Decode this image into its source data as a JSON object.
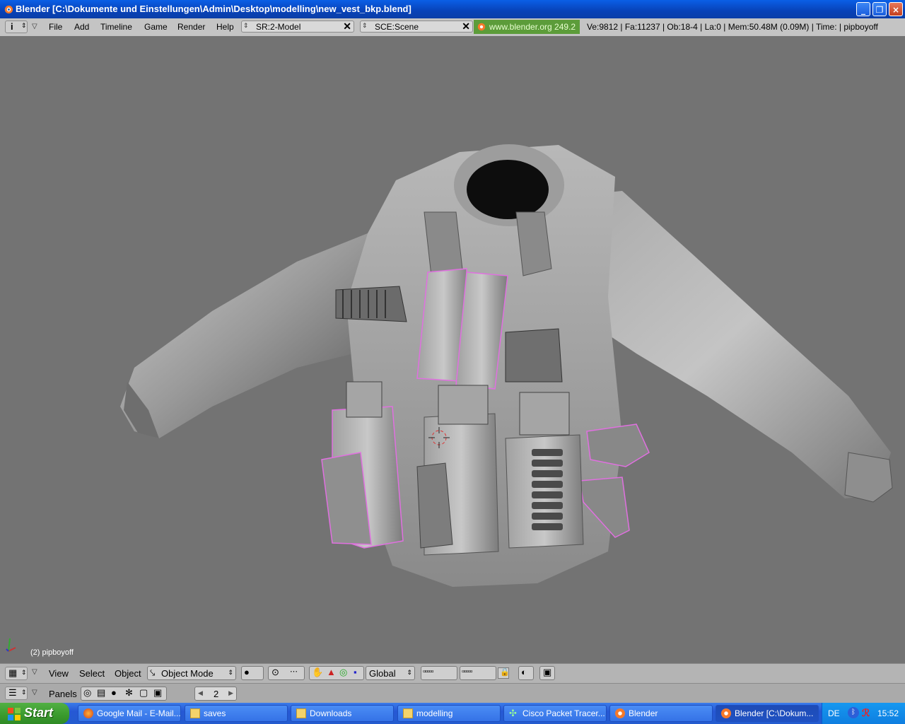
{
  "window": {
    "title": "Blender [C:\\Dokumente und Einstellungen\\Admin\\Desktop\\modelling\\new_vest_bkp.blend]",
    "controls": [
      "_",
      "❐",
      "×"
    ]
  },
  "menubar": {
    "menus": [
      "File",
      "Add",
      "Timeline",
      "Game",
      "Render",
      "Help"
    ],
    "screen_field": "SR:2-Model",
    "scene_field": "SCE:Scene",
    "site_link": "www.blender.org 249.2",
    "stats": "Ve:9812 | Fa:11237 | Ob:18-4 | La:0  | Mem:50.48M (0.09M)  | Time: | pipboyoff"
  },
  "viewport": {
    "object_label": "(2) pipboyoff",
    "background": "#737373",
    "selection_color": "#e070e0"
  },
  "header3d": {
    "menus": [
      "View",
      "Select",
      "Object"
    ],
    "mode": "Object Mode",
    "orientation": "Global"
  },
  "buttons_window": {
    "label": "Panels",
    "frame": "2"
  },
  "taskbar": {
    "start_label": "Start",
    "tasks": [
      {
        "label": "Google Mail - E-Mail...",
        "icon": "firefox-icon"
      },
      {
        "label": "saves",
        "icon": "folder-icon"
      },
      {
        "label": "Downloads",
        "icon": "folder-icon"
      },
      {
        "label": "modelling",
        "icon": "folder-icon"
      },
      {
        "label": "Cisco Packet Tracer...",
        "icon": "packet-tracer-icon"
      },
      {
        "label": "Blender",
        "icon": "blender-icon"
      },
      {
        "label": "Blender [C:\\Dokum...",
        "icon": "blender-icon"
      }
    ],
    "language": "DE",
    "clock": "15:52"
  }
}
